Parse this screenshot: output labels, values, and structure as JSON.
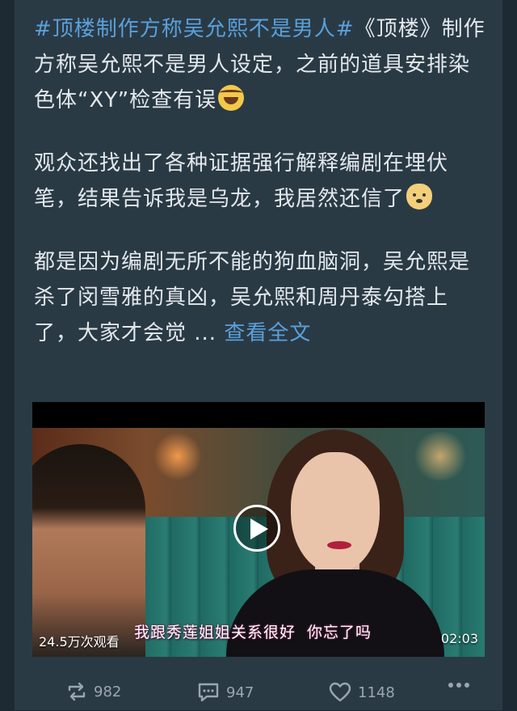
{
  "post": {
    "hashtag": "#顶楼制作方称吴允熙不是男人#",
    "para1_rest": "《顶楼》制作方称吴允熙不是男人设定，之前的道具安排染色体“XY”检查有误",
    "para2": "观众还找出了各种证据强行解释编剧在埋伏笔，结果告诉我是乌龙，我居然还信了",
    "para3": "都是因为编剧无所不能的狗血脑洞，吴允熙是杀了闵雪雅的真凶，吴允熙和周丹泰勾搭上了，大家才会觉 ...",
    "read_more": "查看全文",
    "emojis": [
      "laughing-crying-emoji",
      "doge-emoji"
    ]
  },
  "video": {
    "view_count": "24.5万次观看",
    "duration": "02:03",
    "subtitle_1": "我跟秀莲姐姐关系很好",
    "subtitle_2": "你忘了吗"
  },
  "actions": {
    "repost_count": "982",
    "comment_count": "947",
    "like_count": "1148"
  },
  "colors": {
    "background": "#2a3a45",
    "text": "#e3e8ec",
    "link": "#5aa0da",
    "muted": "#9aa6ae"
  }
}
